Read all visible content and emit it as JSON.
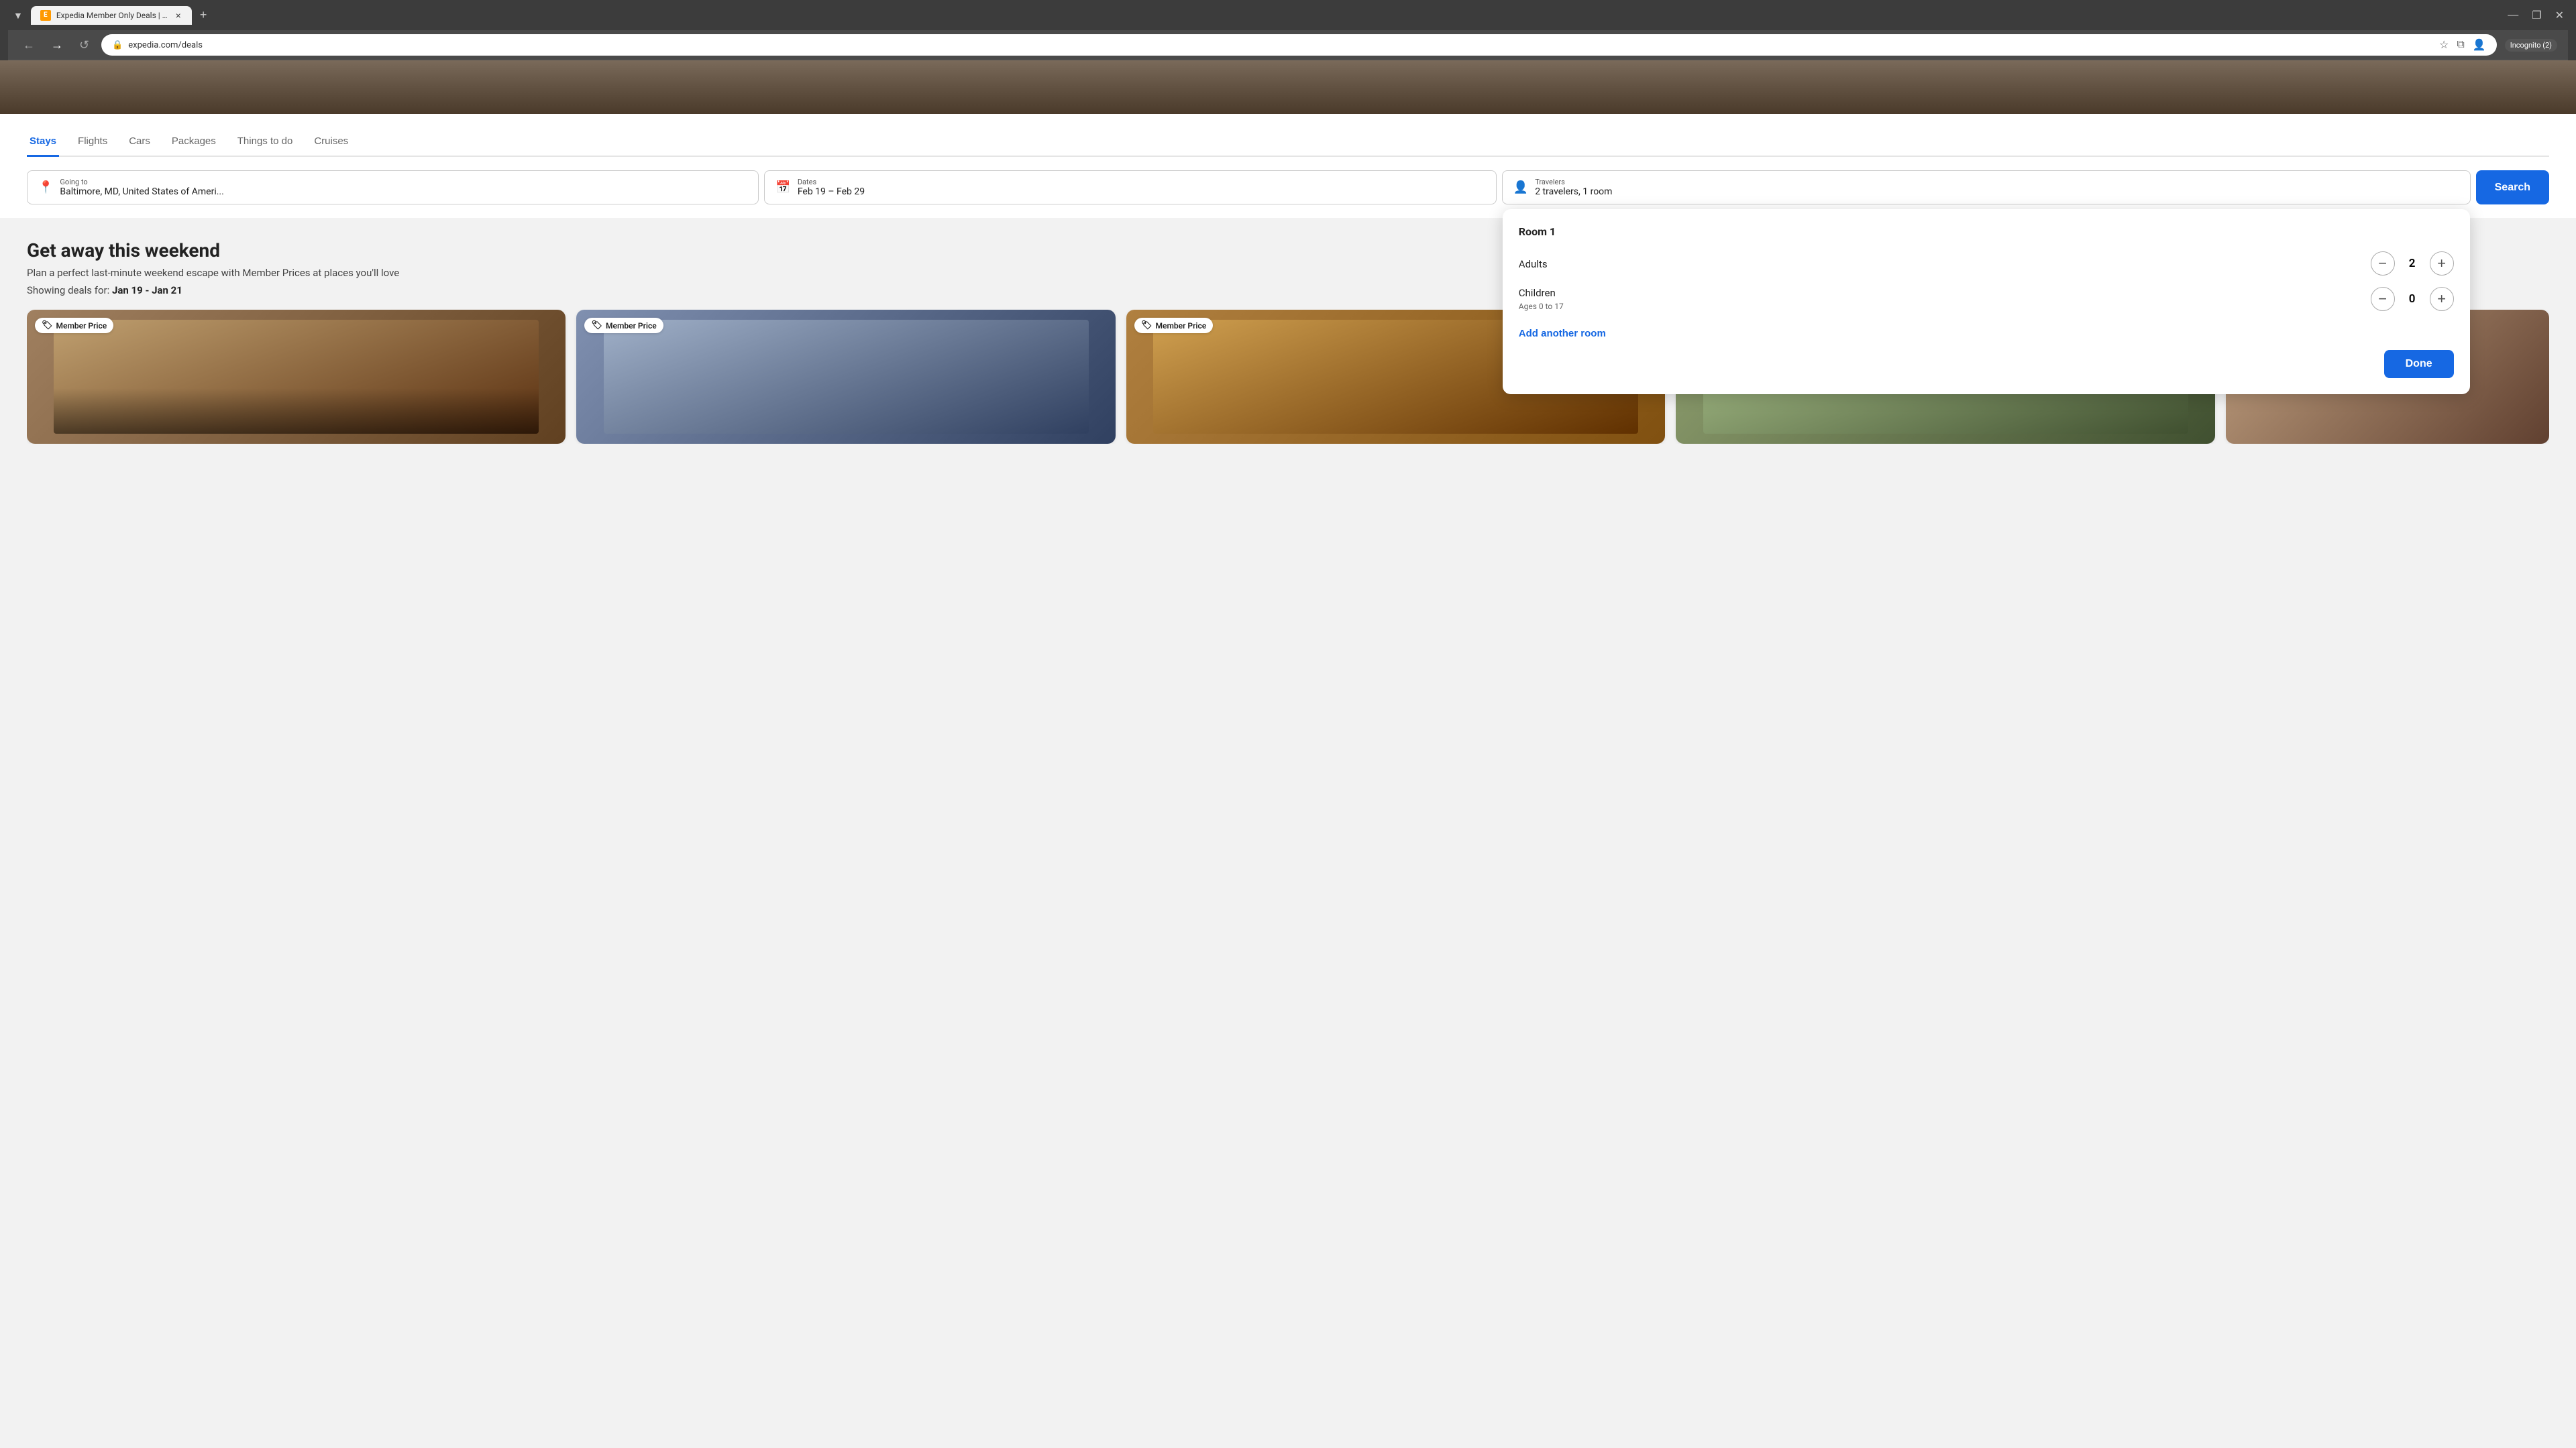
{
  "browser": {
    "tab_group_label": "▼",
    "tab_title": "Expedia Member Only Deals | 2...",
    "tab_favicon": "E",
    "tab_close": "×",
    "new_tab": "+",
    "window_minimize": "—",
    "window_restore": "❐",
    "window_close": "✕",
    "url": "expedia.com/deals",
    "back_btn": "←",
    "forward_btn": "→",
    "refresh_btn": "↺",
    "bookmark_btn": "☆",
    "profile_btn": "👤",
    "incognito_label": "Incognito (2)"
  },
  "search_widget": {
    "tabs": [
      {
        "id": "stays",
        "label": "Stays",
        "active": true
      },
      {
        "id": "flights",
        "label": "Flights",
        "active": false
      },
      {
        "id": "cars",
        "label": "Cars",
        "active": false
      },
      {
        "id": "packages",
        "label": "Packages",
        "active": false
      },
      {
        "id": "things",
        "label": "Things to do",
        "active": false
      },
      {
        "id": "cruises",
        "label": "Cruises",
        "active": false
      }
    ],
    "destination_label": "Going to",
    "destination_value": "Baltimore, MD, United States of Ameri...",
    "dates_label": "Dates",
    "dates_value": "Feb 19 – Feb 29",
    "travelers_label": "Travelers",
    "travelers_value": "2 travelers, 1 room",
    "search_btn_label": "Search"
  },
  "travelers_dropdown": {
    "room_label": "Room 1",
    "adults_label": "Adults",
    "adults_count": 2,
    "children_label": "Children",
    "children_sublabel": "Ages 0 to 17",
    "children_count": 0,
    "add_room_label": "Add another room",
    "done_label": "Done"
  },
  "main": {
    "title": "Get away this weekend",
    "subtitle": "Plan a perfect last-minute weekend escape with Member Prices at places you'll love",
    "deals_prefix": "Showing deals for:",
    "deals_dates": "Jan 19 - Jan 21",
    "member_badge": "Member Price",
    "cards": [
      {
        "id": 1,
        "bg": "linear-gradient(135deg, #a08060 0%, #604020 100%)"
      },
      {
        "id": 2,
        "bg": "linear-gradient(135deg, #8090b0 0%, #304060 100%)"
      },
      {
        "id": 3,
        "bg": "linear-gradient(135deg, #b08040 0%, #805010 100%)"
      },
      {
        "id": 4,
        "bg": "linear-gradient(135deg, #90a070 0%, #405030 100%)"
      },
      {
        "id": 5,
        "bg": "linear-gradient(135deg, #c0a080 0%, #604030 100%)"
      }
    ]
  }
}
